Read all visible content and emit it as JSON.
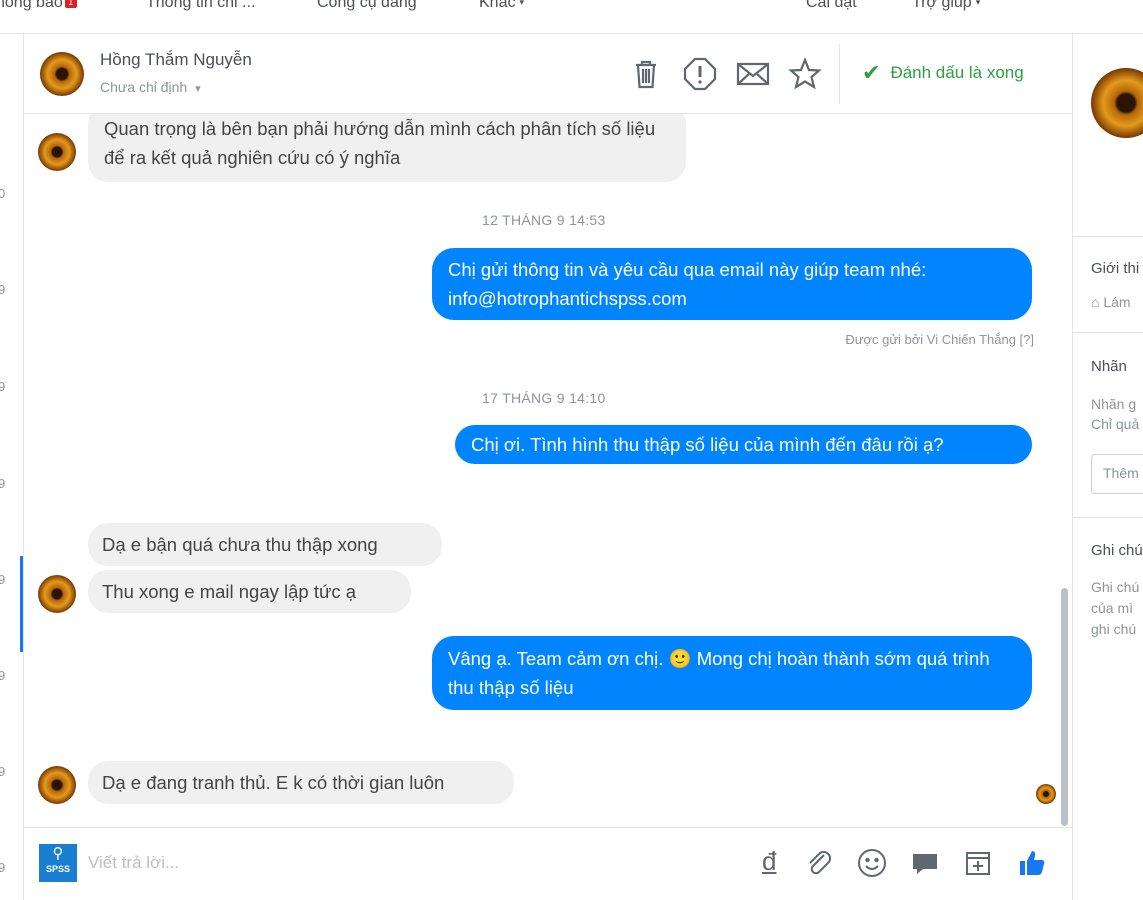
{
  "topnav": {
    "items": [
      "hông báo",
      "Thông tin chi ...",
      "Công cụ đăng",
      "Khác",
      "Cài đặt",
      "Trợ giúp"
    ],
    "notification_badge": "1"
  },
  "left_strip": {
    "ticks": [
      "0",
      "9",
      "9",
      "9",
      "9",
      "9",
      "9",
      "9"
    ]
  },
  "header": {
    "contact_name": "Hồng Thắm Nguyễn",
    "assignee": "Chưa chỉ định",
    "mark_done": "Đánh dấu là xong",
    "icons": [
      "trash-icon",
      "spam-icon",
      "mail-icon",
      "star-icon"
    ]
  },
  "messages": {
    "m1": "Quan trọng là bên bạn phải hướng dẫn mình cách phân tích số liệu để ra kết quả nghiên cứu có ý nghĩa",
    "ts1": "12 THÁNG 9 14:53",
    "m2": "Chị gửi thông tin và yêu cầu qua email này giúp team nhé: info@hotrophantichspss.com",
    "sent_by": "Được gửi bởi Vi Chiến Thắng [?]",
    "ts2": "17 THÁNG 9 14:10",
    "m3": "Chị ơi. Tình hình thu thập số liệu của mình đến đâu rồi ạ?",
    "m4": "Dạ e bận quá chưa thu thập xong",
    "m5": "Thu xong e mail ngay lập tức ạ",
    "m6": "Vâng ạ. Team cảm ơn chị. 🙂 Mong chị hoàn thành sớm quá trình thu thập số liệu",
    "m7": "Dạ e đang tranh thủ. E k có thời gian luôn"
  },
  "composer": {
    "placeholder": "Viết trả lời...",
    "logo_text": "SPSS",
    "currency": "đ",
    "icons": [
      "attach-icon",
      "emoji-icon",
      "saved-reply-icon",
      "appointment-icon",
      "like-icon"
    ]
  },
  "right_panel": {
    "intro_title": "Giới thi",
    "intro_item": "Lám",
    "labels_title": "Nhãn",
    "labels_hint_1": "Nhãn g",
    "labels_hint_2": "Chỉ quả",
    "labels_input": "Thêm",
    "notes_title": "Ghi chú",
    "notes_hint_1": "Ghi chú",
    "notes_hint_2": "của mì",
    "notes_hint_3": "ghi chú"
  },
  "colors": {
    "accent": "#0084ff",
    "done": "#2ea043"
  }
}
